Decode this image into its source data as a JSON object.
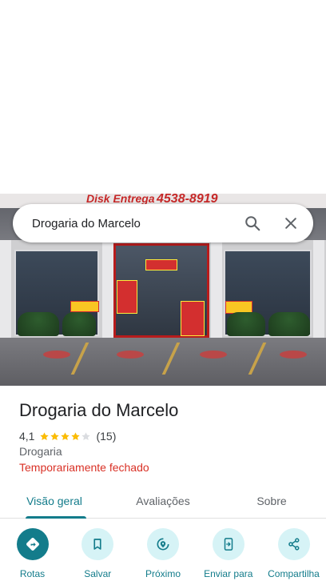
{
  "search": {
    "query": "Drogaria do Marcelo"
  },
  "photo": {
    "sign_left": "Disk Entrega",
    "sign_phone": "4538-8919"
  },
  "place": {
    "name": "Drogaria do Marcelo",
    "rating": "4,1",
    "stars": 4,
    "review_count": "(15)",
    "category": "Drogaria",
    "status": "Temporariamente fechado"
  },
  "tabs": [
    {
      "label": "Visão geral",
      "active": true
    },
    {
      "label": "Avaliações",
      "active": false
    },
    {
      "label": "Sobre",
      "active": false
    }
  ],
  "actions": [
    {
      "label": "Rotas",
      "icon": "directions-icon"
    },
    {
      "label": "Salvar",
      "icon": "bookmark-icon"
    },
    {
      "label": "Próximo",
      "icon": "nearby-icon"
    },
    {
      "label": "Enviar para",
      "icon": "send-to-phone-icon"
    },
    {
      "label": "Compartilha",
      "icon": "share-icon"
    }
  ],
  "colors": {
    "accent": "#137c8b",
    "accent_light": "#d6f3f6",
    "star": "#fbbc04",
    "closed": "#d93025"
  }
}
